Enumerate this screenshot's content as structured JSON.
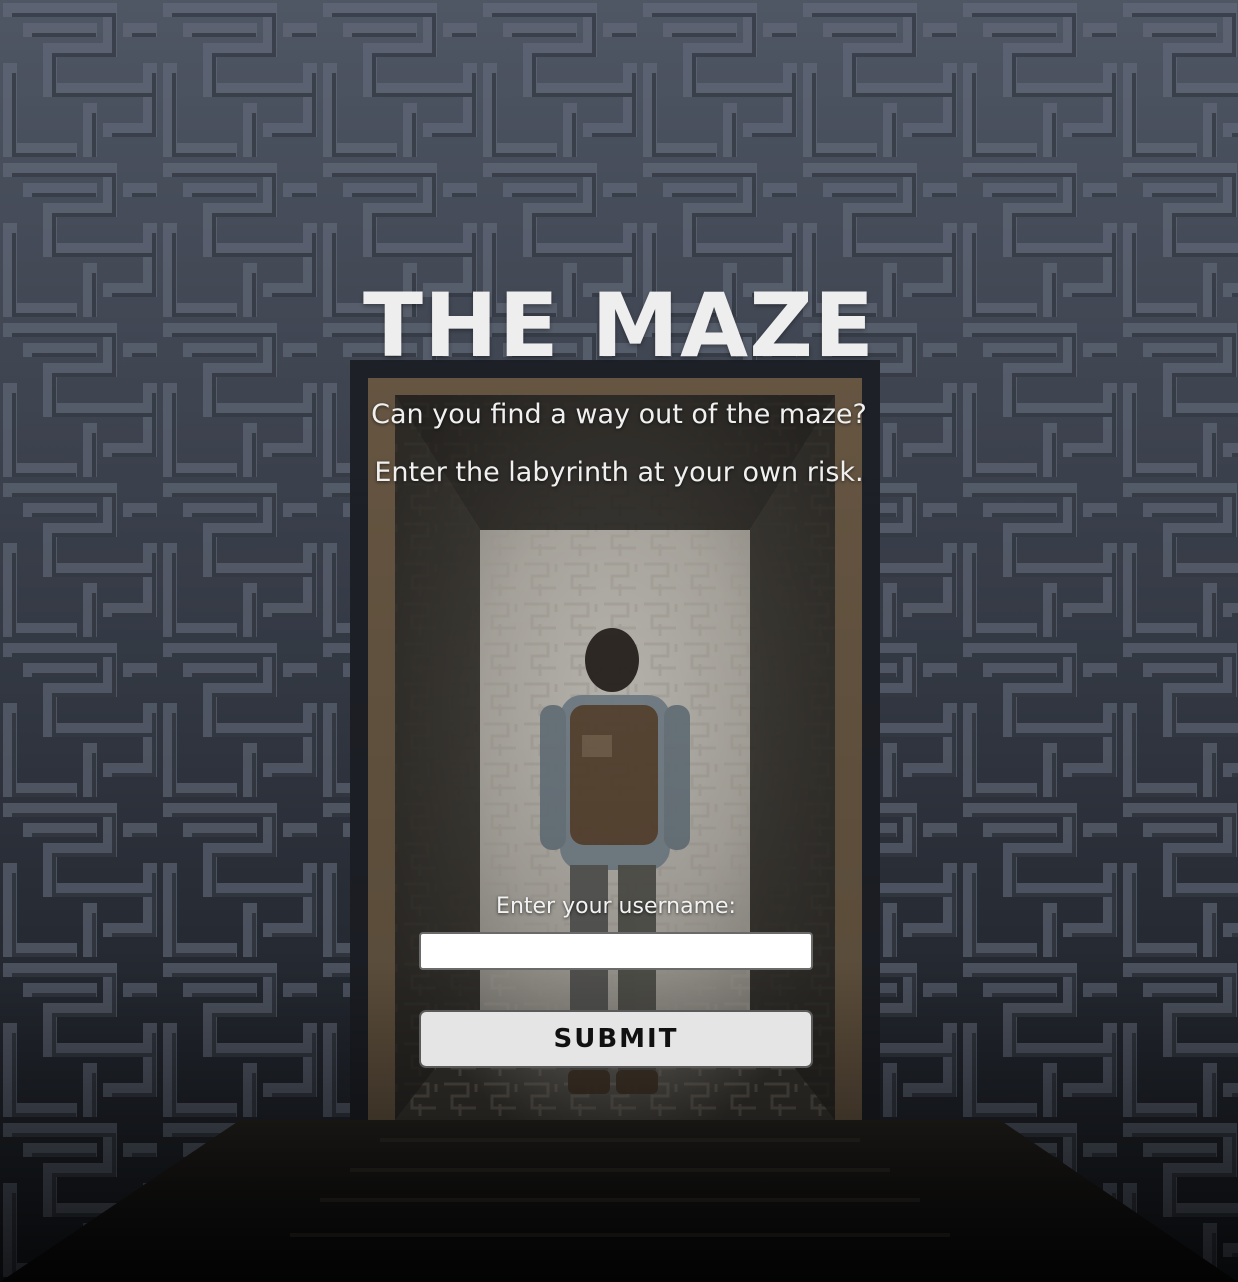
{
  "page": {
    "title": "THE MAZE",
    "taglines": [
      "Can you find a way out of the maze?",
      "Enter the labyrinth at your own risk."
    ]
  },
  "form": {
    "username_label": "Enter your username:",
    "username_value": "",
    "submit_label": "SUBMIT"
  },
  "colors": {
    "wall": "#3d4350",
    "corridor_glow": "#c9c7c2",
    "title_text": "#eeeeee",
    "button_bg": "#e5e5e5"
  }
}
